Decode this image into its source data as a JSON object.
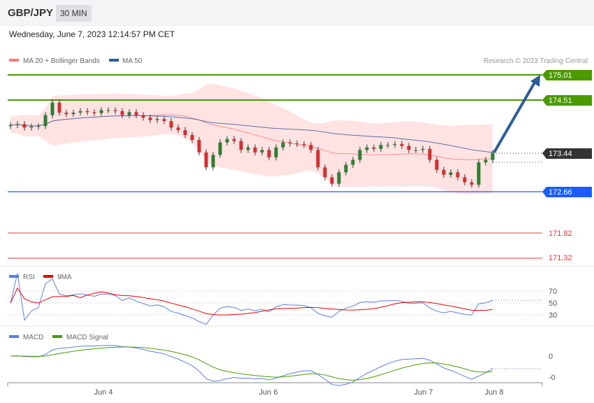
{
  "header": {
    "symbol": "GBP/JPY",
    "timeframe": "30 MIN",
    "datetime": "Wednesday, June 7, 2023 12:14:57 PM CET"
  },
  "legend": {
    "ma20": "MA 20 + Bollinger Bands",
    "ma50": "MA 50",
    "copyright": "Research © 2023 Trading Central"
  },
  "colors": {
    "up": "#2e7d32",
    "down": "#d32f2f",
    "target": "#4a9a00",
    "support": "#1a5cff",
    "last": "#333333",
    "red_level": "#e53935",
    "arrow": "#2d5d9a"
  },
  "levels": {
    "t2": "175.01",
    "t1": "174.51",
    "last": "173.44",
    "pivot": "172.66",
    "s1": "171.82",
    "s2": "171.32"
  },
  "rsi": {
    "label": "RSI",
    "ma_label": "9MA",
    "ticks": [
      "70",
      "50",
      "30"
    ]
  },
  "macd": {
    "label": "MACD",
    "signal_label": "MACD Signal",
    "ticks": [
      "0",
      "-0"
    ]
  },
  "xaxis": [
    "Jun 4",
    "Jun 6",
    "Jun 7",
    "Jun 8"
  ],
  "chart_data": {
    "type": "candlestick",
    "title": "GBP/JPY 30 MIN",
    "closes": [
      174.0,
      174.02,
      173.95,
      173.97,
      173.98,
      174.2,
      174.45,
      174.25,
      174.22,
      174.25,
      174.28,
      174.26,
      174.24,
      174.3,
      174.3,
      174.28,
      174.2,
      174.26,
      174.2,
      174.15,
      174.1,
      174.12,
      174.08,
      173.95,
      173.9,
      173.8,
      173.7,
      173.45,
      173.15,
      173.4,
      173.65,
      173.72,
      173.68,
      173.5,
      173.55,
      173.45,
      173.5,
      173.35,
      173.55,
      173.65,
      173.63,
      173.62,
      173.6,
      173.5,
      173.15,
      172.95,
      172.82,
      173.05,
      173.2,
      173.3,
      173.5,
      173.55,
      173.52,
      173.6,
      173.6,
      173.62,
      173.58,
      173.5,
      173.5,
      173.52,
      173.3,
      173.1,
      173.0,
      173.05,
      172.95,
      172.85,
      172.8,
      173.25,
      173.3,
      173.44
    ],
    "ylim": [
      171.2,
      175.2
    ]
  }
}
